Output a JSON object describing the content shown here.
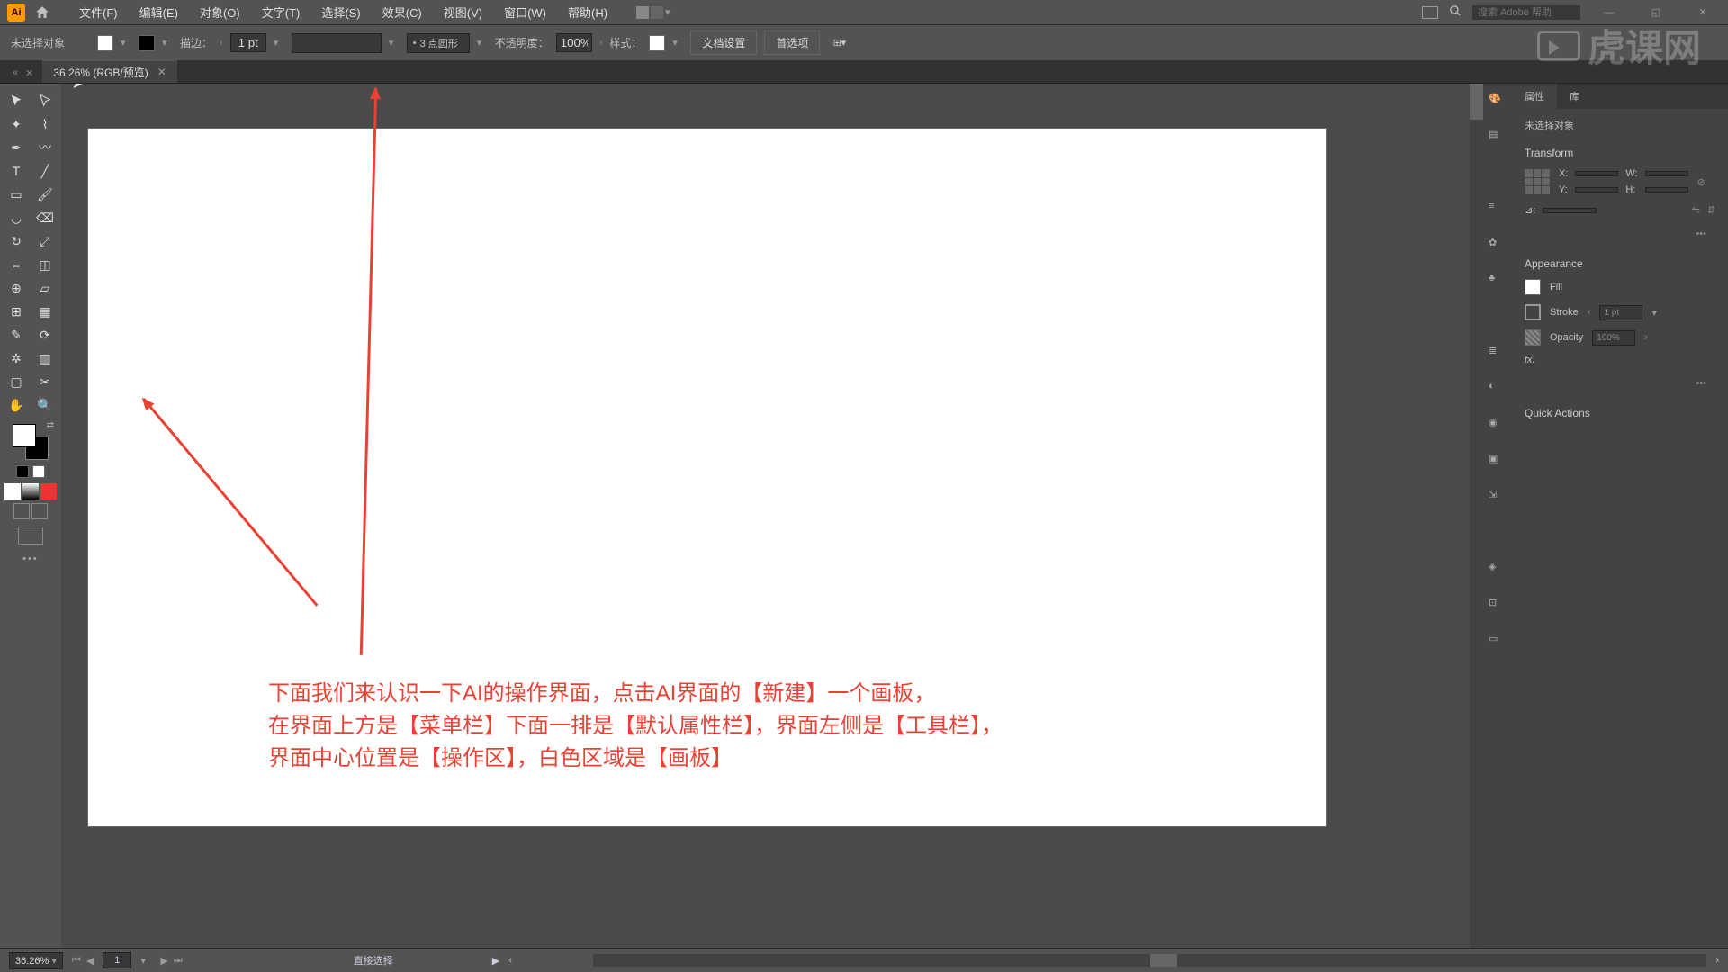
{
  "menu": {
    "items": [
      "文件(F)",
      "编辑(E)",
      "对象(O)",
      "文字(T)",
      "选择(S)",
      "效果(C)",
      "视图(V)",
      "窗口(W)",
      "帮助(H)"
    ],
    "search_placeholder": "搜索 Adobe 帮助"
  },
  "control": {
    "noselect": "未选择对象",
    "stroke_label": "描边：",
    "stroke_value": "1 pt",
    "stroke_style": "3 点圆形",
    "opacity_label": "不透明度：",
    "opacity_value": "100%",
    "style_label": "样式：",
    "doc_setup": "文档设置",
    "prefs": "首选项"
  },
  "doc": {
    "tab": "36.26% (RGB/预览)",
    "zoom": "36.26%",
    "artboard_num": "1",
    "tool_status": "直接选择"
  },
  "panel": {
    "tabs": [
      "属性",
      "库"
    ],
    "noselect": "未选择对象",
    "transform": "Transform",
    "x": "X:",
    "y": "Y:",
    "w": "W:",
    "h": "H:",
    "angle": "⊿:",
    "appearance": "Appearance",
    "fill": "Fill",
    "stroke": "Stroke",
    "stroke_val": "1 pt",
    "opacity": "Opacity",
    "opacity_val": "100%",
    "fx": "fx.",
    "quick": "Quick Actions"
  },
  "annot": {
    "l1": "下面我们来认识一下AI的操作界面，点击AI界面的【新建】一个画板，",
    "l2": "在界面上方是【菜单栏】下面一排是【默认属性栏】，界面左侧是【工具栏】，",
    "l3": "界面中心位置是【操作区】，白色区域是【画板】"
  },
  "watermark": "虎课网"
}
